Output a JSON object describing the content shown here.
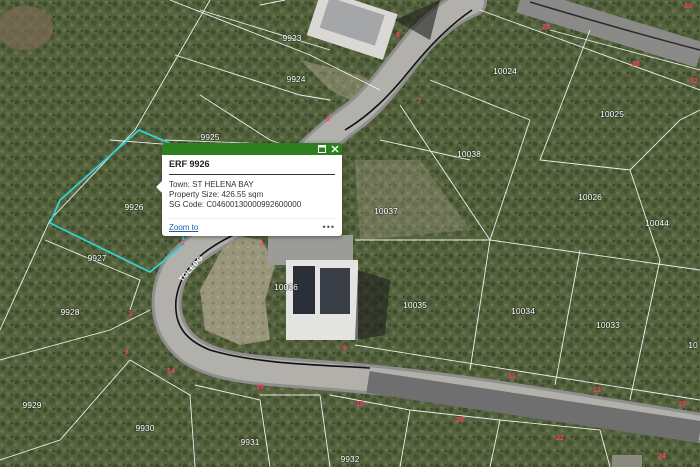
{
  "map": {
    "parcels": [
      {
        "id": "9923",
        "label": "9923"
      },
      {
        "id": "9924",
        "label": "9924"
      },
      {
        "id": "9925",
        "label": "9925"
      },
      {
        "id": "9926",
        "label": "9926"
      },
      {
        "id": "9927",
        "label": "9927"
      },
      {
        "id": "9928",
        "label": "9928"
      },
      {
        "id": "9929",
        "label": "9929"
      },
      {
        "id": "9930",
        "label": "9930"
      },
      {
        "id": "9931",
        "label": "9931"
      },
      {
        "id": "9932",
        "label": "9932"
      },
      {
        "id": "10024",
        "label": "10024"
      },
      {
        "id": "10025",
        "label": "10025"
      },
      {
        "id": "10026",
        "label": "10026"
      },
      {
        "id": "10033",
        "label": "10033"
      },
      {
        "id": "10034",
        "label": "10034"
      },
      {
        "id": "10035",
        "label": "10035"
      },
      {
        "id": "10036",
        "label": "10036"
      },
      {
        "id": "10037",
        "label": "10037"
      },
      {
        "id": "10038",
        "label": "10038"
      },
      {
        "id": "10044",
        "label": "10044"
      },
      {
        "id": "1004x",
        "label": "10"
      }
    ],
    "street_name": "TOLEDO",
    "road_numbers": [
      "8",
      "7",
      "6",
      "5",
      "4",
      "1",
      "2",
      "3",
      "4",
      "5",
      "6",
      "9",
      "11",
      "13",
      "14",
      "15",
      "16",
      "18",
      "20",
      "22",
      "23",
      "24",
      "28",
      "30",
      "32"
    ],
    "highlight_color": "#33d1d6",
    "road_number_color": "#ff3b6b"
  },
  "popup": {
    "title": "ERF 9926",
    "town_label": "Town:",
    "town_value": "ST HELENA BAY",
    "size_label": "Property Size:",
    "size_value": "426.55 sqm",
    "sg_label": "SG Code:",
    "sg_value": "C04600130000992600000",
    "zoom_label": "Zoom to",
    "more_label": "•••",
    "header_color": "#2e7d1f"
  }
}
